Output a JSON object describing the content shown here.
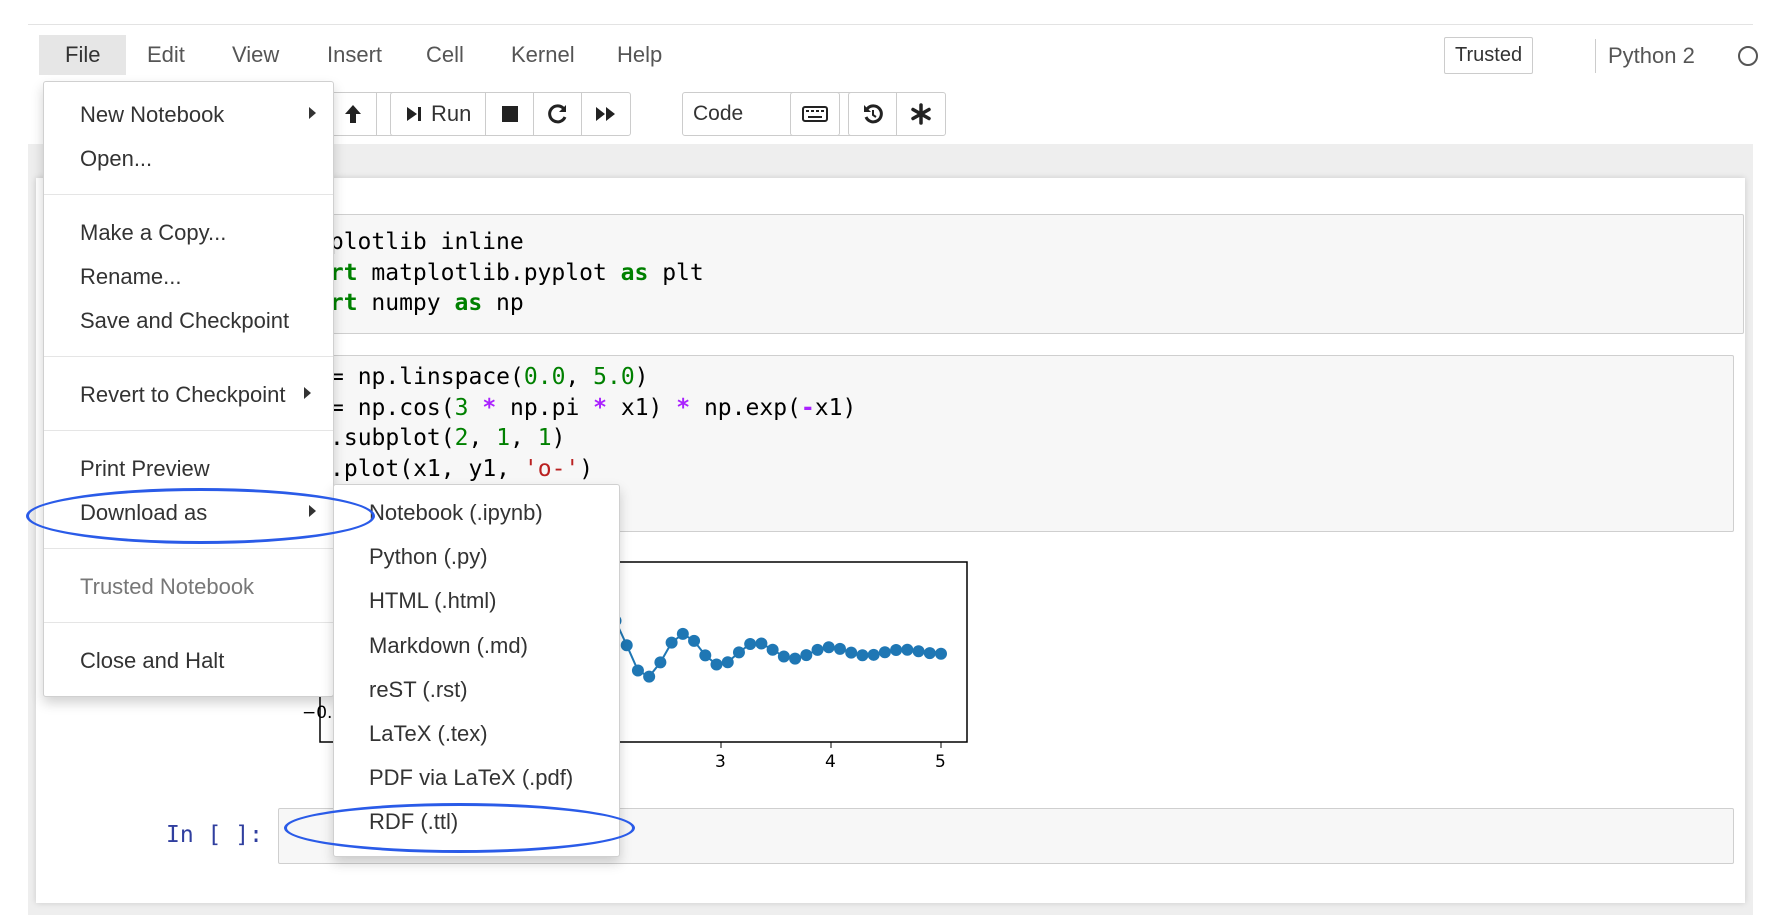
{
  "menubar": {
    "items": [
      {
        "label": "File"
      },
      {
        "label": "Edit"
      },
      {
        "label": "View"
      },
      {
        "label": "Insert"
      },
      {
        "label": "Cell"
      },
      {
        "label": "Kernel"
      },
      {
        "label": "Help"
      }
    ],
    "trusted_label": "Trusted",
    "kernel_name": "Python 2"
  },
  "toolbar": {
    "run_label": "Run",
    "cell_type": "Code",
    "icons": [
      "arrow-up-icon",
      "arrow-down-icon",
      "step-forward-icon",
      "stop-icon",
      "restart-icon",
      "fast-forward-icon",
      "keyboard-icon",
      "history-icon",
      "asterisk-icon"
    ]
  },
  "cells": {
    "cell1": [
      "tplotlib inline",
      "ort matplotlib.pyplot as plt",
      "ort numpy as np"
    ],
    "cell2": [
      "= np.linspace(0.0, 5.0)",
      "= np.cos(3 * np.pi * x1) * np.exp(-x1)",
      ".subplot(2, 1, 1)",
      ".plot(x1, y1, 'o-')"
    ],
    "empty_prompt": "In [ ]:"
  },
  "plot": {
    "ytick_partial": "−0.",
    "xticks": [
      "3",
      "4",
      "5"
    ]
  },
  "file_menu": {
    "items": [
      {
        "label": "New Notebook",
        "has_submenu": true
      },
      {
        "label": "Open..."
      },
      {
        "label": "Make a Copy..."
      },
      {
        "label": "Rename..."
      },
      {
        "label": "Save and Checkpoint"
      },
      {
        "label": "Revert to Checkpoint",
        "has_submenu": true
      },
      {
        "label": "Print Preview"
      },
      {
        "label": "Download as",
        "has_submenu": true
      },
      {
        "label": "Trusted Notebook",
        "disabled": true
      },
      {
        "label": "Close and Halt"
      }
    ]
  },
  "download_submenu": {
    "items": [
      {
        "label": "Notebook (.ipynb)"
      },
      {
        "label": "Python (.py)"
      },
      {
        "label": "HTML (.html)"
      },
      {
        "label": "Markdown (.md)"
      },
      {
        "label": "reST (.rst)"
      },
      {
        "label": "LaTeX (.tex)"
      },
      {
        "label": "PDF via LaTeX (.pdf)"
      },
      {
        "label": "RDF (.ttl)"
      }
    ]
  },
  "colors": {
    "annotation": "#2a5be8",
    "plot_series": "#1f77b4",
    "keyword": "#008000",
    "operator": "#aa22ff",
    "string": "#ba2121",
    "prompt": "#303f9f"
  }
}
